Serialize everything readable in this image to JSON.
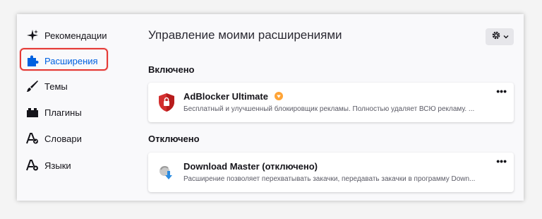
{
  "sidebar": {
    "items": [
      {
        "label": "Рекомендации",
        "icon": "recommendations-sparkle-icon"
      },
      {
        "label": "Расширения",
        "icon": "puzzle-piece-icon"
      },
      {
        "label": "Темы",
        "icon": "brush-icon"
      },
      {
        "label": "Плагины",
        "icon": "plugin-icon"
      },
      {
        "label": "Словари",
        "icon": "dictionary-icon"
      },
      {
        "label": "Языки",
        "icon": "languages-icon"
      }
    ]
  },
  "main": {
    "title": "Управление моими расширениями",
    "settings_icon": "gear-icon",
    "enabled_heading": "Включено",
    "disabled_heading": "Отключено",
    "enabled_extensions": [
      {
        "name": "AdBlocker Ultimate",
        "description": "Бесплатный и улучшенный блокировщик рекламы. Полностью удаляет ВСЮ рекламу. ...",
        "more": "•••",
        "icon": "shield-lock-icon",
        "badge": "recommended-badge-icon"
      }
    ],
    "disabled_extensions": [
      {
        "name": "Download Master (отключено)",
        "description": "Расширение позволяет перехватывать закачки, передавать закачки в программу Down...",
        "more": "•••",
        "icon": "download-master-icon"
      }
    ]
  },
  "colors": {
    "accent": "#0061e0",
    "highlight": "#e53935",
    "shield": "#d32f2f",
    "badge": "#ffa436"
  }
}
